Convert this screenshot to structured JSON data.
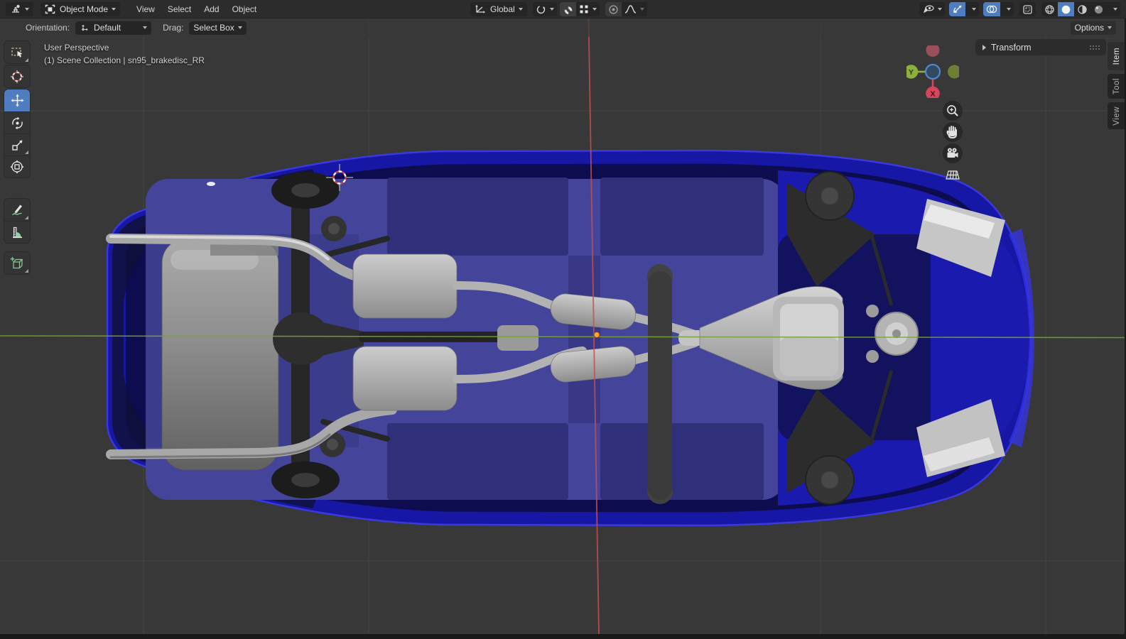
{
  "header": {
    "editor_type": "3D Viewport",
    "mode": "Object Mode",
    "menus": [
      "View",
      "Select",
      "Add",
      "Object"
    ],
    "orientation": "Global"
  },
  "tool_settings": {
    "orientation_label": "Orientation:",
    "orientation_value": "Default",
    "drag_label": "Drag:",
    "drag_value": "Select Box",
    "options": "Options"
  },
  "toolbar": {
    "active_tool": "move",
    "tools": [
      "select-box",
      "cursor",
      "move",
      "rotate",
      "scale",
      "transform",
      "annotate",
      "measure",
      "add-cube"
    ]
  },
  "viewport": {
    "view_label": "User Perspective",
    "context_label": "(1) Scene Collection | sn95_brakedisc_RR",
    "gizmo": {
      "x": "X",
      "y": "Y"
    },
    "shading_active": "solid"
  },
  "sidebar": {
    "panel": "Transform",
    "tabs": [
      "Item",
      "Tool",
      "View"
    ],
    "active_tab": "Item"
  },
  "colors": {
    "accent_blue": "#4f7dc0",
    "axis_x": "#c4504f",
    "axis_y": "#76a530",
    "car_body": "#1717a6",
    "car_floor": "#44449a",
    "origin_dot": "#ffa33b"
  }
}
